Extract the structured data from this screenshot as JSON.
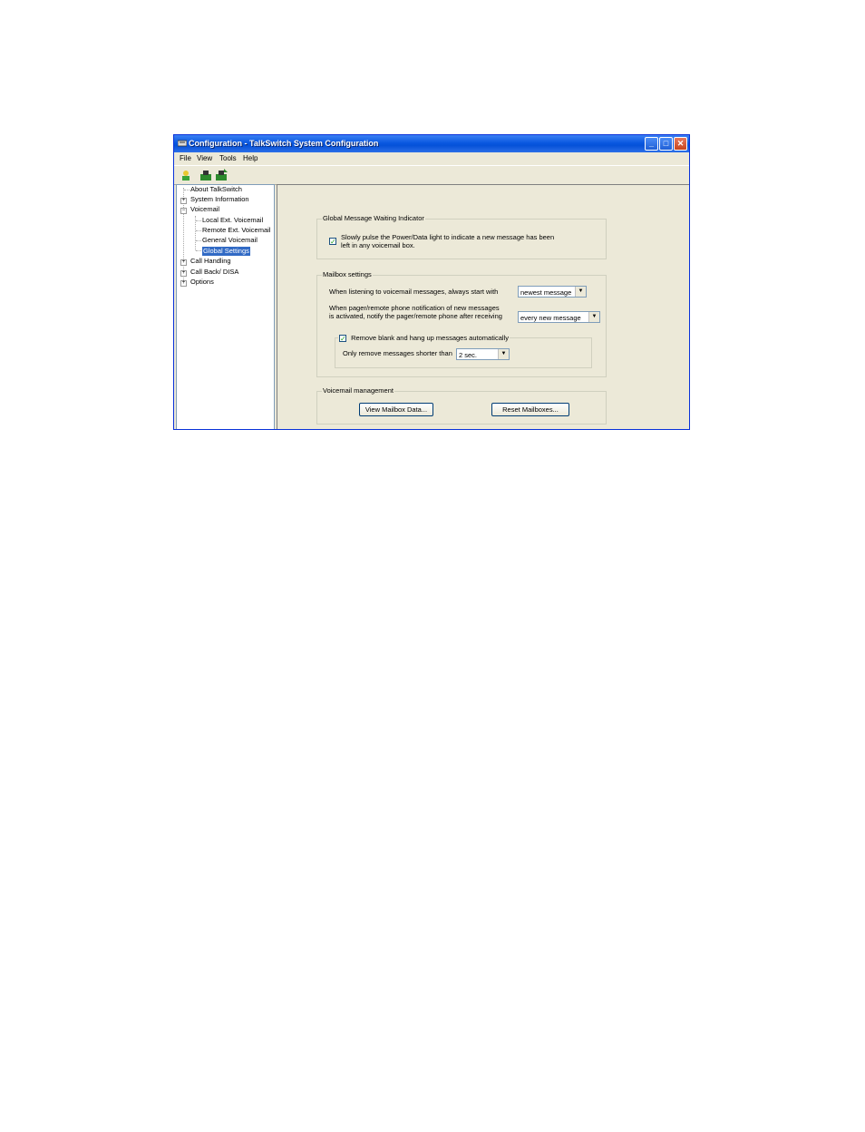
{
  "window": {
    "title": "Configuration - TalkSwitch System Configuration",
    "minimize": "_",
    "maximize": "□",
    "close": "✕"
  },
  "menu": [
    "File",
    "View",
    "Tools",
    "Help"
  ],
  "tree": {
    "expander_plus": "+",
    "expander_minus": "−",
    "items": [
      {
        "label": "About TalkSwitch"
      },
      {
        "label": "System Information"
      },
      {
        "label": "Voicemail"
      },
      {
        "label": "Local Ext. Voicemail"
      },
      {
        "label": "Remote Ext. Voicemail"
      },
      {
        "label": "General Voicemail"
      },
      {
        "label": "Global Settings"
      },
      {
        "label": "Call Handling"
      },
      {
        "label": "Call Back/ DISA"
      },
      {
        "label": "Options"
      }
    ]
  },
  "gmwi": {
    "title": "Global Message Waiting Indicator",
    "checkbox_label_line1": "Slowly pulse the Power/Data light to indicate a new message has been",
    "checkbox_label_line2": "left in any voicemail box.",
    "checked_mark": "✓"
  },
  "mailbox": {
    "title": "Mailbox settings",
    "start_label": "When listening to voicemail messages, always start with",
    "start_value": "newest message",
    "notify_label_line1": "When pager/remote phone notification of new messages",
    "notify_label_line2": "is activated, notify the pager/remote phone after receiving",
    "notify_value": "every new message",
    "remove_label": "Remove blank and hang up messages automatically",
    "shorter_label": "Only remove messages shorter than",
    "shorter_value": "2 sec.",
    "checked_mark": "✓",
    "dropdown_arrow": "▼"
  },
  "vm_mgmt": {
    "title": "Voicemail management",
    "view_button": "View Mailbox Data...",
    "reset_button": "Reset Mailboxes..."
  }
}
